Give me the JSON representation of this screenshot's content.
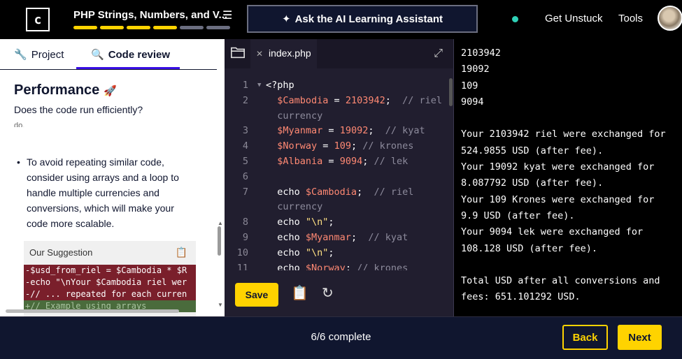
{
  "header": {
    "logo_glyph": "c",
    "course_title": "PHP Strings, Numbers, and V...",
    "progress_segments": [
      "#ffd300",
      "#ffd300",
      "#ffd300",
      "#ffd300",
      "#6b6e80",
      "#6b6e80"
    ],
    "ai_button_label": "Ask the AI Learning Assistant",
    "get_unstuck_label": "Get Unstuck",
    "tools_label": "Tools"
  },
  "left_panel": {
    "tabs": [
      {
        "label": "Project"
      },
      {
        "label": "Code review"
      }
    ],
    "section_title": "Performance",
    "section_subtitle": "Does the code run efficiently?",
    "cut_text": "do.",
    "bullet": "To avoid repeating similar code, consider using arrays and a loop to handle multiple currencies and conversions, which will make your code more scalable.",
    "suggestion": {
      "title": "Our Suggestion",
      "lines": [
        {
          "type": "minus",
          "text": "-$usd_from_riel = $Cambodia * $R"
        },
        {
          "type": "minus",
          "text": "-echo \"\\nYour $Cambodia riel wer"
        },
        {
          "type": "minus",
          "text": "-// ... repeated for each curren"
        },
        {
          "type": "plus",
          "text": "+// Example using arrays"
        }
      ]
    }
  },
  "editor": {
    "file_tab": "index.php",
    "lines": [
      {
        "num": "1",
        "fold": true,
        "html": "<span class=\"k\">&lt;?php</span>"
      },
      {
        "num": "2",
        "html": "  <span class=\"v\">$Cambodia</span> = <span class=\"n\">2103942</span>;  <span class=\"c\">// riel</span>"
      },
      {
        "num": "",
        "html": "  <span class=\"c\">currency</span>"
      },
      {
        "num": "3",
        "html": "  <span class=\"v\">$Myanmar</span> = <span class=\"n\">19092</span>;  <span class=\"c\">// kyat</span>"
      },
      {
        "num": "4",
        "html": "  <span class=\"v\">$Norway</span> = <span class=\"n\">109</span>; <span class=\"c\">// krones</span>"
      },
      {
        "num": "5",
        "html": "  <span class=\"v\">$Albania</span> = <span class=\"n\">9094</span>; <span class=\"c\">// lek</span>"
      },
      {
        "num": "6",
        "html": ""
      },
      {
        "num": "7",
        "html": "  echo <span class=\"v\">$Cambodia</span>;  <span class=\"c\">// riel</span>"
      },
      {
        "num": "",
        "html": "  <span class=\"c\">currency</span>"
      },
      {
        "num": "8",
        "html": "  echo <span class=\"s\">\"\\n\"</span>;"
      },
      {
        "num": "9",
        "html": "  echo <span class=\"v\">$Myanmar</span>;  <span class=\"c\">// kyat</span>"
      },
      {
        "num": "10",
        "html": "  echo <span class=\"s\">\"\\n\"</span>;"
      },
      {
        "num": "11",
        "html": "  echo <span class=\"v\">$Norway</span>; <span class=\"c\">// krones</span>"
      }
    ],
    "save_label": "Save"
  },
  "output": {
    "text": "2103942\n19092\n109\n9094\n\nYour 2103942 riel were exchanged for 524.9855 USD (after fee).\nYour 19092 kyat were exchanged for 8.087792 USD (after fee).\nYour 109 Krones were exchanged for 9.9 USD (after fee).\nYour 9094 lek were exchanged for 108.128 USD (after fee).\n\nTotal USD after all conversions and fees: 651.101292 USD."
  },
  "footer": {
    "progress_text": "6/6 complete",
    "back_label": "Back",
    "next_label": "Next"
  }
}
